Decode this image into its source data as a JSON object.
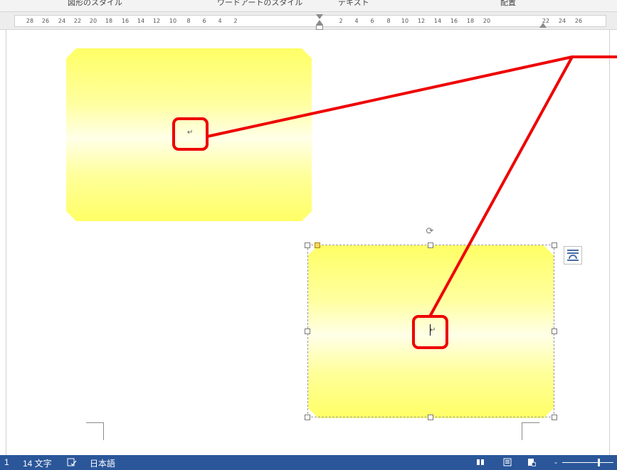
{
  "ribbon": {
    "groups": [
      "図形のスタイル",
      "ワードアートのスタイル",
      "テキスト",
      "配置"
    ]
  },
  "ruler": {
    "ticks": [
      "28",
      "26",
      "24",
      "22",
      "20",
      "18",
      "16",
      "14",
      "12",
      "10",
      "8",
      "6",
      "4",
      "2",
      "",
      "2",
      "4",
      "6",
      "8",
      "10",
      "12",
      "14",
      "16",
      "18",
      "20",
      "22",
      "24",
      "26"
    ]
  },
  "document": {
    "shape_top_paragraph_mark": "↵",
    "shape_bottom_paragraph_mark": "↵",
    "rotate_icon": "⟳"
  },
  "statusbar": {
    "page_info": "1",
    "word_count": "14 文字",
    "proofing_icon": "proofing-icon",
    "language": "日本語",
    "zoom_minus": "-"
  },
  "colors": {
    "callout": "#ee0000",
    "statusbar": "#2b579a",
    "shape_fill": "#ffff66"
  }
}
